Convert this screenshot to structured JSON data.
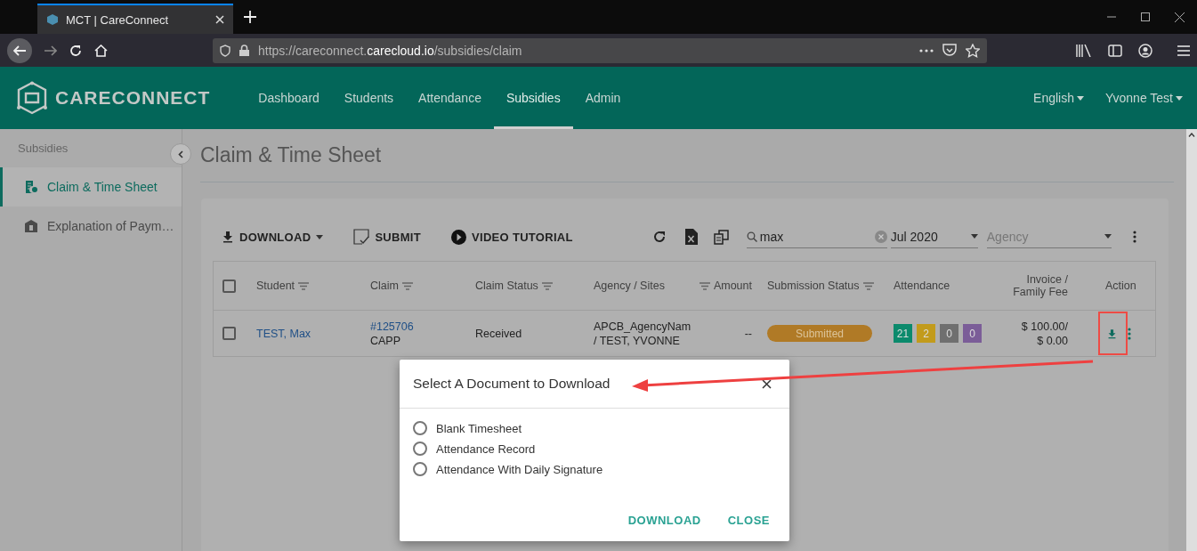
{
  "browser": {
    "tab_title": "MCT | CareConnect",
    "url": "https://careconnect.**carecloud.io**/subsidies/claim"
  },
  "header": {
    "brand": "CARECONNECT",
    "nav": [
      {
        "label": "Dashboard",
        "selected": false
      },
      {
        "label": "Students",
        "selected": false
      },
      {
        "label": "Attendance",
        "selected": false
      },
      {
        "label": "Subsidies",
        "selected": true
      },
      {
        "label": "Admin",
        "selected": false
      }
    ],
    "language": "English",
    "user": "Yvonne Test"
  },
  "sidebar": {
    "heading": "Subsidies",
    "items": [
      {
        "label": "Claim & Time Sheet",
        "selected": true
      },
      {
        "label": "Explanation of Paym…",
        "selected": false
      }
    ]
  },
  "page_title": "Claim & Time Sheet",
  "toolbar": {
    "download": "DOWNLOAD",
    "submit": "SUBMIT",
    "video": "VIDEO TUTORIAL",
    "search": "max",
    "month": "Jul 2020",
    "agency_placeholder": "Agency"
  },
  "table": {
    "all_checked": false,
    "columns": [
      {
        "label": "Student",
        "kind": "filter"
      },
      {
        "label": "Claim",
        "kind": "filter"
      },
      {
        "label": "Claim Status",
        "kind": "filter"
      },
      {
        "label": "Agency / Sites",
        "kind": "plain"
      },
      {
        "label": "Amount",
        "kind": "prefilter"
      },
      {
        "label": "Submission Status",
        "kind": "filter"
      },
      {
        "label": "Attendance",
        "kind": "plain"
      },
      {
        "label": "Invoice / Family Fee",
        "kind": "plain"
      },
      {
        "label": "Action",
        "kind": "plain"
      }
    ],
    "rows": [
      {
        "checked": false,
        "student": "TEST, Max",
        "claim_id": "#125706",
        "claim_type": "CAPP",
        "claim_status": "Received",
        "agency_lines": [
          "APCB_AgencyNam",
          "/ TEST, YVONNE"
        ],
        "amount": "--",
        "submission_status": "Submitted",
        "attendance": [
          {
            "value": "21",
            "color": "#0b8a6c"
          },
          {
            "value": "2",
            "color": "#c29b1c"
          },
          {
            "value": "0",
            "color": "#6f6f6f"
          },
          {
            "value": "0",
            "color": "#7b5d98"
          }
        ],
        "invoice_lines": [
          "$ 100.00/",
          "$ 0.00"
        ]
      }
    ]
  },
  "dialog": {
    "title": "Select A Document to Download",
    "options": [
      {
        "label": "Blank Timesheet",
        "selected": false
      },
      {
        "label": "Attendance Record",
        "selected": false
      },
      {
        "label": "Attendance With Daily Signature",
        "selected": false
      }
    ],
    "buttons": [
      "DOWNLOAD",
      "CLOSE"
    ]
  }
}
